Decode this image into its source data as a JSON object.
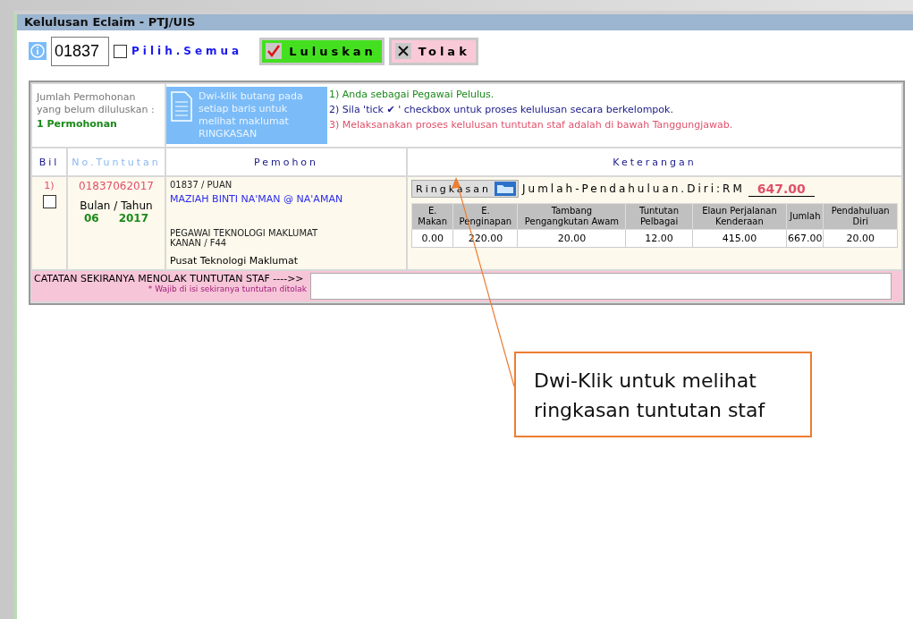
{
  "window": {
    "title": "Kelulusan Eclaim - PTJ/UIS"
  },
  "toolbar": {
    "staff_id": "01837",
    "select_all": {
      "label": "Pilih.Semua",
      "checked": false
    },
    "approve_button": "Luluskan",
    "reject_button": "Tolak"
  },
  "summary": {
    "label": "Jumlah Permohonan yang belum diluluskan :",
    "count": "1 Permohonan",
    "hint": "Dwi-klik butang pada setiap baris untuk melihat maklumat RINGKASAN",
    "notes": [
      {
        "text": "1) Anda sebagai Pegawai Pelulus.",
        "color": "#1a8a1a"
      },
      {
        "text": "2) Sila 'tick ✔ ' checkbox untuk proses kelulusan secara berkelompok.",
        "color": "#1a1a8a"
      },
      {
        "text": "3) Melaksanakan proses kelulusan tuntutan staf adalah di bawah Tanggungjawab.",
        "color": "#e0506a"
      }
    ]
  },
  "table": {
    "columns": [
      "Bil",
      "No.Tuntutan",
      "Pemohon",
      "Keterangan"
    ],
    "rows": [
      {
        "bil": "1)",
        "checked": false,
        "claim_no": "01837062017",
        "period_label": "Bulan / Tahun",
        "month": "06",
        "year": "2017",
        "staff": "01837 / PUAN",
        "name": "MAZIAH BINTI NA'MAN @ NA'AMAN",
        "position": "PEGAWAI TEKNOLOGI MAKLUMAT KANAN / F44",
        "department": "Pusat Teknologi Maklumat",
        "summary_button": "Ringkasan",
        "advance_label": "Jumlah-Pendahuluan.Diri:RM",
        "advance_value": "647.00",
        "detail_columns": [
          "E. Makan",
          "E. Penginapan",
          "Tambang Pengangkutan Awam",
          "Tuntutan Pelbagai",
          "Elaun Perjalanan Kenderaan",
          "Jumlah",
          "Pendahuluan Diri"
        ],
        "detail_values": [
          "0.00",
          "220.00",
          "20.00",
          "12.00",
          "415.00",
          "667.00",
          "20.00"
        ]
      }
    ]
  },
  "reject_note": {
    "label": "CATATAN SEKIRANYA MENOLAK TUNTUTAN STAF ---->>",
    "hint": "* Wajib di isi sekiranya tuntutan ditolak"
  },
  "callout": {
    "text": "Dwi-Klik untuk melihat ringkasan tuntutan staf"
  }
}
